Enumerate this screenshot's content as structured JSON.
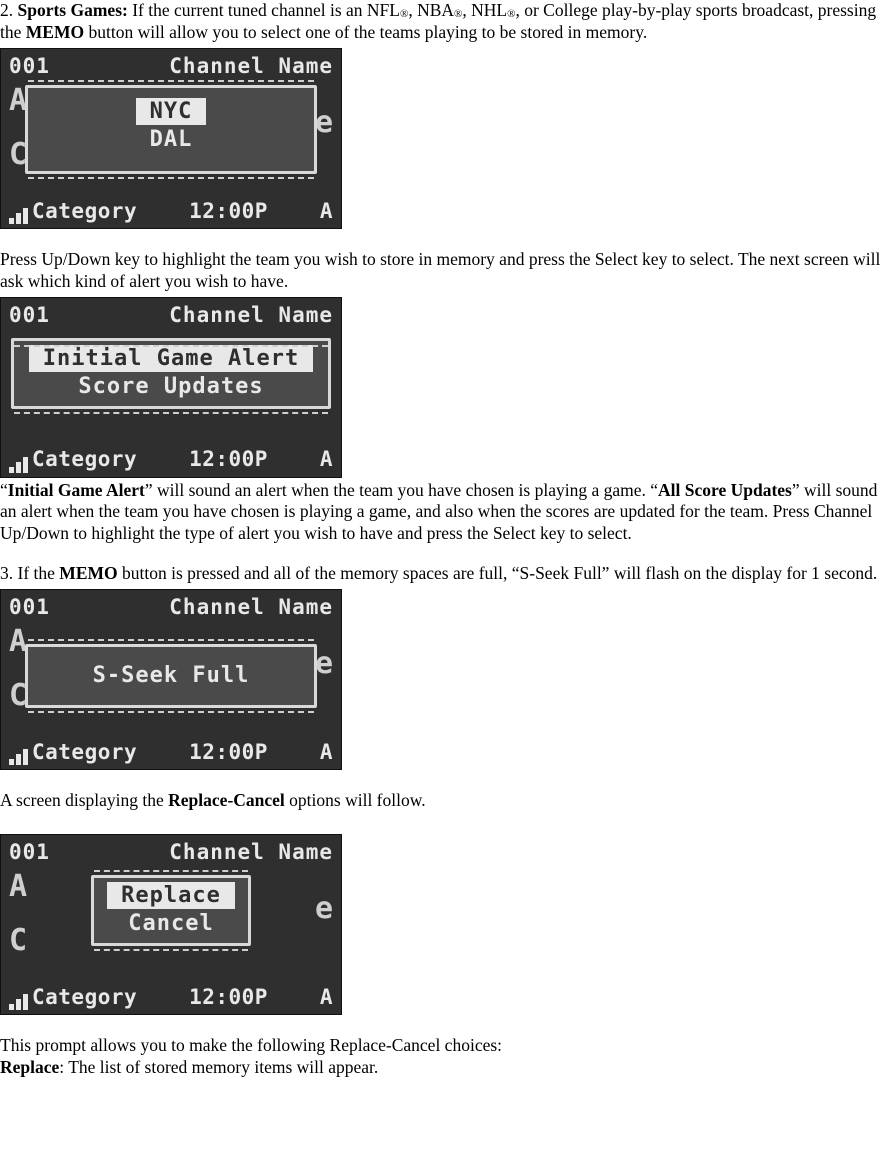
{
  "para1": {
    "prefix": "2. ",
    "bold1": "Sports Games:",
    "text1": " If the current tuned channel is an NFL",
    "reg": "®",
    "text2": ", NBA",
    "text3": ", NHL",
    "text4": ", or College play-by-play sports broadcast, pressing the ",
    "bold2": "MEMO",
    "text5": " button will allow you to select one of the teams playing to be stored in memory."
  },
  "lcd_common": {
    "channel_num": "001",
    "channel_name": "Channel Name",
    "category": "Category",
    "time": "12:00P",
    "ant": "A",
    "bg_left_a": "A",
    "bg_left_c": "C",
    "bg_right": "e"
  },
  "lcd1": {
    "sel": "NYC",
    "line2": "DAL"
  },
  "para2": "Press Up/Down key to highlight the team you wish to store in memory and press the Select key to select. The next screen will ask which kind of alert you wish to have.",
  "lcd2": {
    "sel": "Initial Game Alert",
    "line2": "Score Updates"
  },
  "para3": {
    "q1": "“",
    "bold1": "Initial Game Alert",
    "text1": "” will sound an alert when the team you have chosen is playing a game. “",
    "bold2": "All Score Updates",
    "text2": "” will sound an alert when the team you have chosen is playing a game, and also when the scores are updated for the team. Press Channel Up/Down to highlight the type of alert you wish to have and press the Select key to select."
  },
  "para4": {
    "prefix": "3. If the ",
    "bold1": "MEMO",
    "text1": " button is pressed and all of the memory spaces are full, “S-Seek Full” will flash on the display for 1 second."
  },
  "lcd3": {
    "line1": "S-Seek Full"
  },
  "para5": {
    "text1": "A screen displaying the ",
    "bold1": "Replace-Cancel",
    "text2": " options will follow."
  },
  "lcd4": {
    "sel": "Replace",
    "line2": "Cancel"
  },
  "para6": "This prompt allows you to make the following Replace-Cancel choices:",
  "para7": {
    "bold1": "Replace",
    "text1": ": The list of stored memory items will appear."
  }
}
